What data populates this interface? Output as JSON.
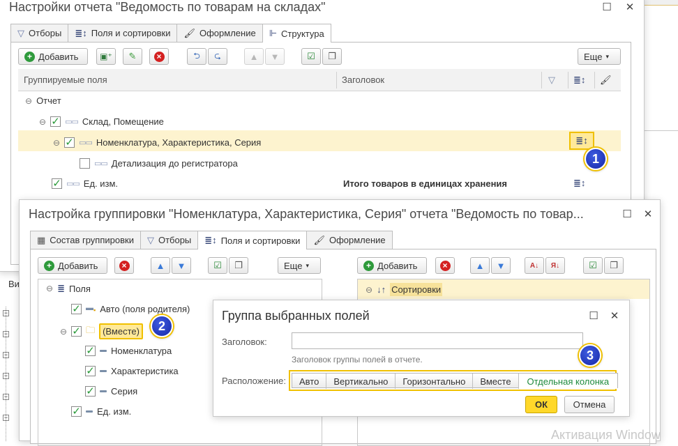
{
  "main_window": {
    "title": "Настройки отчета \"Ведомость по товарам на складах\"",
    "tabs": [
      {
        "label": "Отборы",
        "icon": "filter-icon"
      },
      {
        "label": "Поля и сортировки",
        "icon": "fields-sort-icon"
      },
      {
        "label": "Оформление",
        "icon": "brush-icon"
      },
      {
        "label": "Структура",
        "icon": "structure-icon",
        "active": true
      }
    ],
    "toolbar": {
      "add_label": "Добавить",
      "more_label": "Еще"
    },
    "columns": {
      "group_fields": "Группируемые поля",
      "header": "Заголовок"
    },
    "tree": [
      {
        "label": "Отчет",
        "level": 0
      },
      {
        "label": "Склад, Помещение",
        "level": 1,
        "checked": true
      },
      {
        "label": "Номенклатура, Характеристика, Серия",
        "level": 2,
        "checked": true,
        "selected": true
      },
      {
        "label": "Детализация до регистратора",
        "level": 3,
        "checked": false
      },
      {
        "label": "Ед. изм.",
        "level": 1,
        "checked": true,
        "header": "Итого товаров в единицах хранения"
      }
    ],
    "side_label": "Ви"
  },
  "group_window": {
    "title": "Настройка группировки \"Номенклатура, Характеристика, Серия\" отчета \"Ведомость по товар...",
    "tabs": [
      {
        "label": "Состав группировки",
        "icon": "table-icon"
      },
      {
        "label": "Отборы",
        "icon": "filter-icon"
      },
      {
        "label": "Поля и сортировки",
        "icon": "fields-sort-icon",
        "active": true
      },
      {
        "label": "Оформление",
        "icon": "brush-icon"
      }
    ],
    "left_toolbar": {
      "add_label": "Добавить",
      "more_label": "Еще"
    },
    "right_toolbar": {
      "add_label": "Добавить"
    },
    "fields_tree": [
      {
        "label": "Поля",
        "level": 0
      },
      {
        "label": "Авто (поля родителя)",
        "level": 1,
        "checked": true
      },
      {
        "label": "(Вместе)",
        "level": 1,
        "checked": true,
        "folder": true
      },
      {
        "label": "Номенклатура",
        "level": 2,
        "checked": true
      },
      {
        "label": "Характеристика",
        "level": 2,
        "checked": true
      },
      {
        "label": "Серия",
        "level": 2,
        "checked": true
      },
      {
        "label": "Ед. изм.",
        "level": 1,
        "checked": true
      }
    ],
    "sort_tree": [
      {
        "label": "Сортировки",
        "level": 0
      }
    ]
  },
  "dialog": {
    "title": "Группа выбранных полей",
    "header_label": "Заголовок:",
    "header_value": "",
    "header_hint": "Заголовок группы полей в отчете.",
    "placement_label": "Расположение:",
    "placement_options": [
      "Авто",
      "Вертикально",
      "Горизонтально",
      "Вместе",
      "Отдельная колонка"
    ],
    "placement_selected": "Отдельная колонка",
    "ok_label": "ОК",
    "cancel_label": "Отмена"
  },
  "badges": [
    "1",
    "2",
    "3"
  ],
  "watermark": "Активация Window",
  "colors": {
    "highlight": "#fdf3cf",
    "accent_border": "#e9c200",
    "ok_button": "#ffd82a",
    "selected_option": "#1e8a3c"
  }
}
